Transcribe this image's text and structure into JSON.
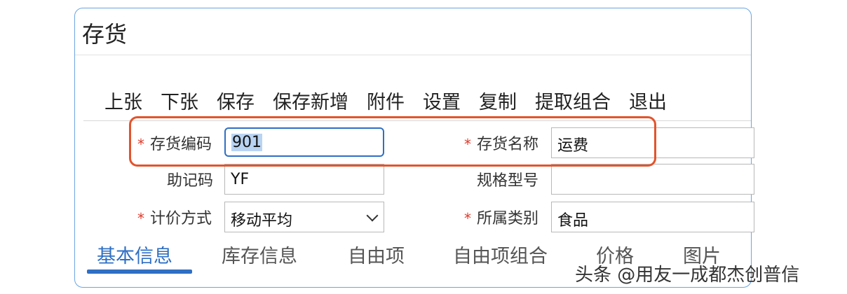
{
  "window": {
    "title": "存货"
  },
  "toolbar": {
    "buttons": [
      "上张",
      "下张",
      "保存",
      "保存新增",
      "附件",
      "设置",
      "复制",
      "提取组合",
      "退出"
    ]
  },
  "form": {
    "required_mark": "*",
    "code": {
      "label": "存货编码",
      "value": "901"
    },
    "name": {
      "label": "存货名称",
      "value": "运费"
    },
    "mnemonic": {
      "label": "助记码",
      "value": "YF"
    },
    "spec": {
      "label": "规格型号",
      "value": ""
    },
    "pricing": {
      "label": "计价方式",
      "value": "移动平均"
    },
    "category": {
      "label": "所属类别",
      "value": "食品"
    }
  },
  "tabs": [
    "基本信息",
    "库存信息",
    "自由项",
    "自由项组合",
    "价格",
    "图片"
  ],
  "active_tab": "基本信息",
  "watermark": "头条 @用友一成都杰创普信",
  "colors": {
    "accent": "#2f6fc4",
    "highlight_box": "#e2542c",
    "required": "#e03a2a"
  }
}
